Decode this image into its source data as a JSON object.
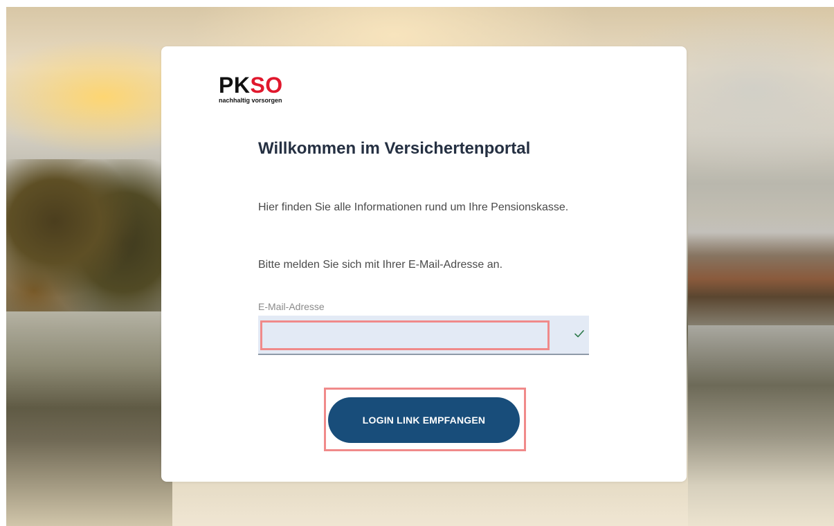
{
  "brand": {
    "logo_letters_black": "PK",
    "logo_letters_red": "SO",
    "tagline": "nachhaltig vorsorgen"
  },
  "login": {
    "title": "Willkommen im Versichertenportal",
    "intro": "Hier finden Sie alle Informationen rund um Ihre Pensionskasse.",
    "instruction": "Bitte melden Sie sich mit Ihrer E-Mail-Adresse an.",
    "email_label": "E-Mail-Adresse",
    "email_value": "",
    "submit_label": "LOGIN LINK EMPFANGEN"
  },
  "icons": {
    "field_status": "check-icon"
  },
  "colors": {
    "brand_red": "#e0182d",
    "button_blue": "#184d7a",
    "input_bg": "#e3eaf5",
    "highlight": "#f08a8a",
    "check_green": "#2e7a4b"
  }
}
